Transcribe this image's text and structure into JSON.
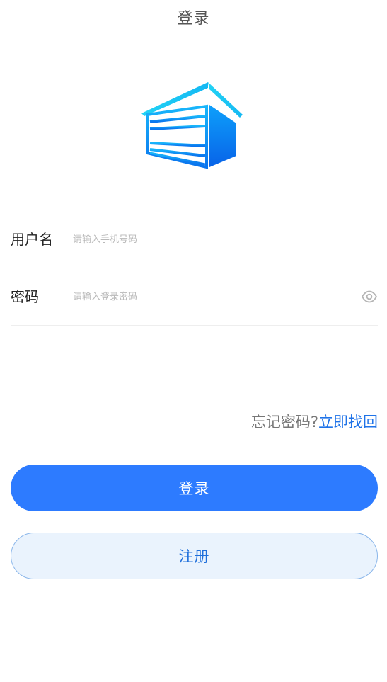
{
  "header": {
    "title": "登录"
  },
  "logo": {
    "icon": "warehouse-icon",
    "colors": {
      "roof": "#19c6f0",
      "body_light": "#12a6ff",
      "body_dark": "#0a6cf0"
    }
  },
  "form": {
    "username": {
      "label": "用户名",
      "placeholder": "请输入手机号码",
      "value": ""
    },
    "password": {
      "label": "密码",
      "placeholder": "请输入登录密码",
      "value": "",
      "toggle_icon": "eye-icon"
    }
  },
  "forgot": {
    "question": "忘记密码?",
    "link": "立即找回"
  },
  "buttons": {
    "login": "登录",
    "register": "注册"
  },
  "colors": {
    "accent": "#2d7bff",
    "link": "#1f73e8",
    "register_bg": "#eaf3fd"
  }
}
